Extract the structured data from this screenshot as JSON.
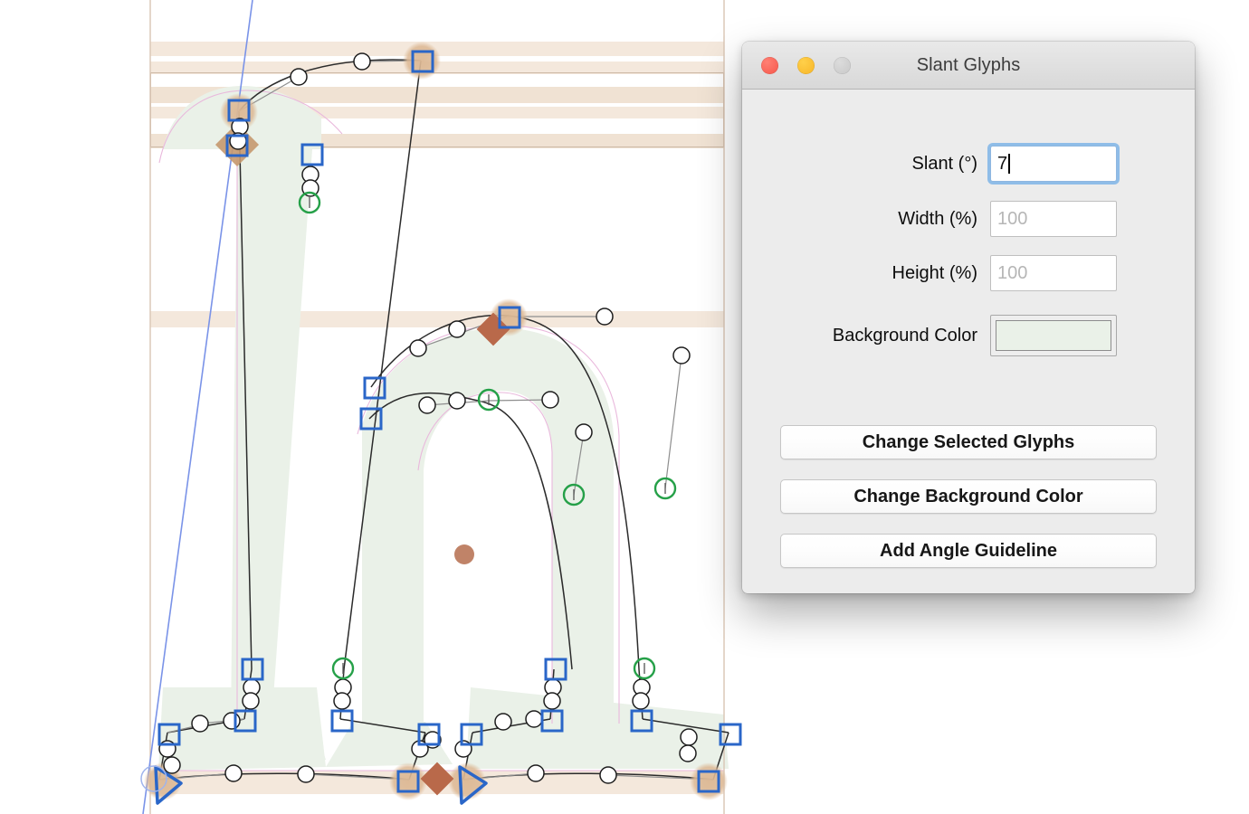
{
  "window": {
    "title": "Slant Glyphs",
    "controls": {
      "close": "close-button",
      "minimize": "minimize-button",
      "zoom": "zoom-button"
    }
  },
  "form": {
    "fields": [
      {
        "label": "Slant (°)",
        "value": "7",
        "placeholder": "",
        "focused": true
      },
      {
        "label": "Width (%)",
        "value": "",
        "placeholder": "100",
        "focused": false
      },
      {
        "label": "Height (%)",
        "value": "",
        "placeholder": "100",
        "focused": false
      }
    ],
    "color_row": {
      "label": "Background Color",
      "swatch_color": "#eaf1e8"
    }
  },
  "buttons": [
    {
      "label": "Change Selected Glyphs"
    },
    {
      "label": "Change Background Color"
    },
    {
      "label": "Add Angle Guideline"
    }
  ],
  "canvas": {
    "name": "glyph-edit-canvas",
    "description": "Font editor canvas showing an 'h'-like glyph outline with bezier nodes",
    "colors": {
      "glyph_fill": "#eaf1e8",
      "metric_band": "#f4e8dc",
      "metric_band_strong": "#e5d4c2",
      "outline": "#2a2a2a",
      "node_blue": "#2a66c8",
      "node_green": "#25a048",
      "marker_terracotta": "#b9694a",
      "halo": "#dcb894",
      "guideline_blue": "#7a93e8",
      "outline_pink": "#e9b8dc",
      "sidebearing": "#d9c5b4"
    }
  }
}
